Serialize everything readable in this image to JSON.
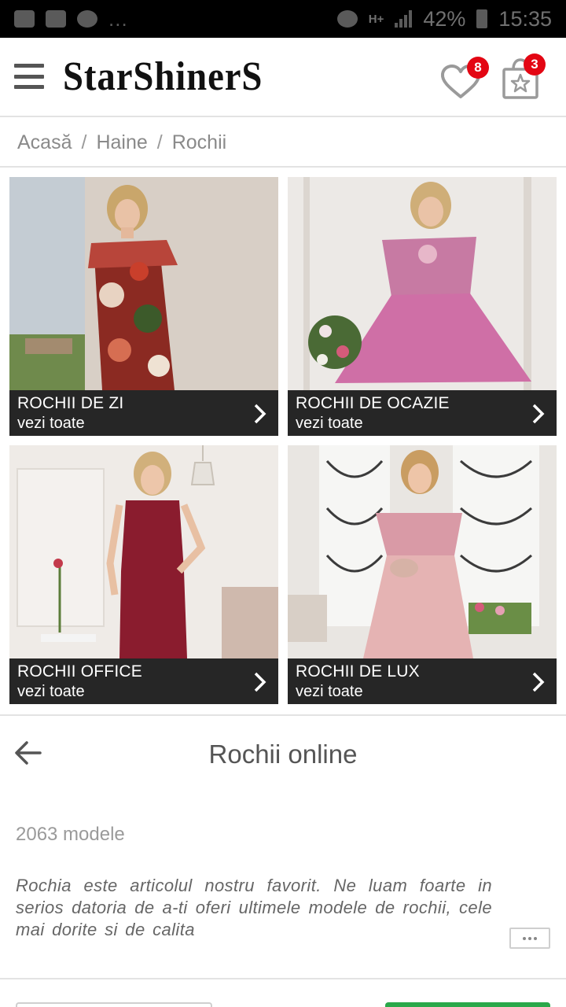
{
  "status_bar": {
    "dots": "...",
    "network": "H+",
    "battery": "42%",
    "time": "15:35"
  },
  "header": {
    "logo": "StarShinerS",
    "wishlist_count": "8",
    "cart_count": "3"
  },
  "breadcrumb": {
    "items": [
      "Acasă",
      "Haine",
      "Rochii"
    ],
    "separator": "/"
  },
  "categories": [
    {
      "title": "ROCHII DE ZI",
      "subtitle": "vezi toate"
    },
    {
      "title": "ROCHII DE OCAZIE",
      "subtitle": "vezi toate"
    },
    {
      "title": "ROCHII OFFICE",
      "subtitle": "vezi toate"
    },
    {
      "title": "ROCHII DE LUX",
      "subtitle": "vezi toate"
    }
  ],
  "section": {
    "title": "Rochii online",
    "count": "2063 modele",
    "description": "Rochia este articolul nostru favorit. Ne luam foarte in serios datoria de a-ti oferi ultimele modele de rochii, cele mai dorite si de calita"
  },
  "colors": {
    "badge": "#e30613",
    "caption_bg": "#262626",
    "accent_green": "#2aa84a"
  }
}
